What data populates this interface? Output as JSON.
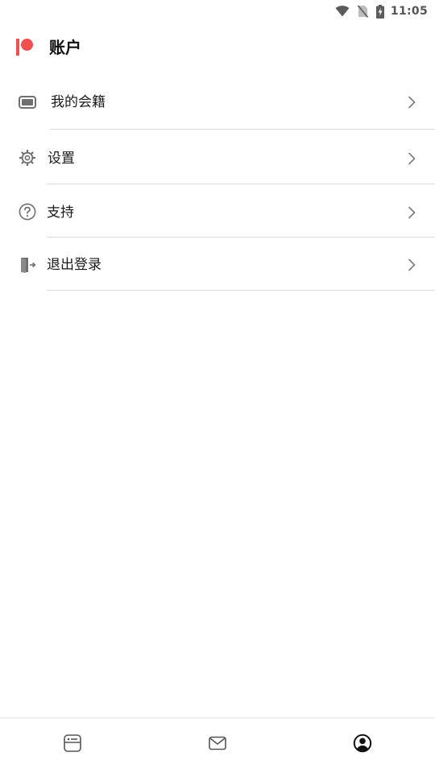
{
  "status_bar": {
    "time": "11:05",
    "icons": [
      "wifi-icon",
      "no-sim-icon",
      "battery-charging-icon"
    ]
  },
  "header": {
    "title": "账户",
    "logo": "patreon-logo",
    "brand_color": "#f0514e"
  },
  "menu": {
    "items": [
      {
        "label": "我的会籍",
        "icon": "membership-card-icon"
      },
      {
        "label": "设置",
        "icon": "gear-icon"
      },
      {
        "label": "支持",
        "icon": "help-circle-icon"
      },
      {
        "label": "退出登录",
        "icon": "logout-icon"
      }
    ],
    "trailing_icon": "chevron-right-icon"
  },
  "bottom_nav": {
    "tabs": [
      {
        "icon": "feed-icon",
        "active": false
      },
      {
        "icon": "messages-icon",
        "active": false
      },
      {
        "icon": "account-icon",
        "active": true
      }
    ]
  }
}
